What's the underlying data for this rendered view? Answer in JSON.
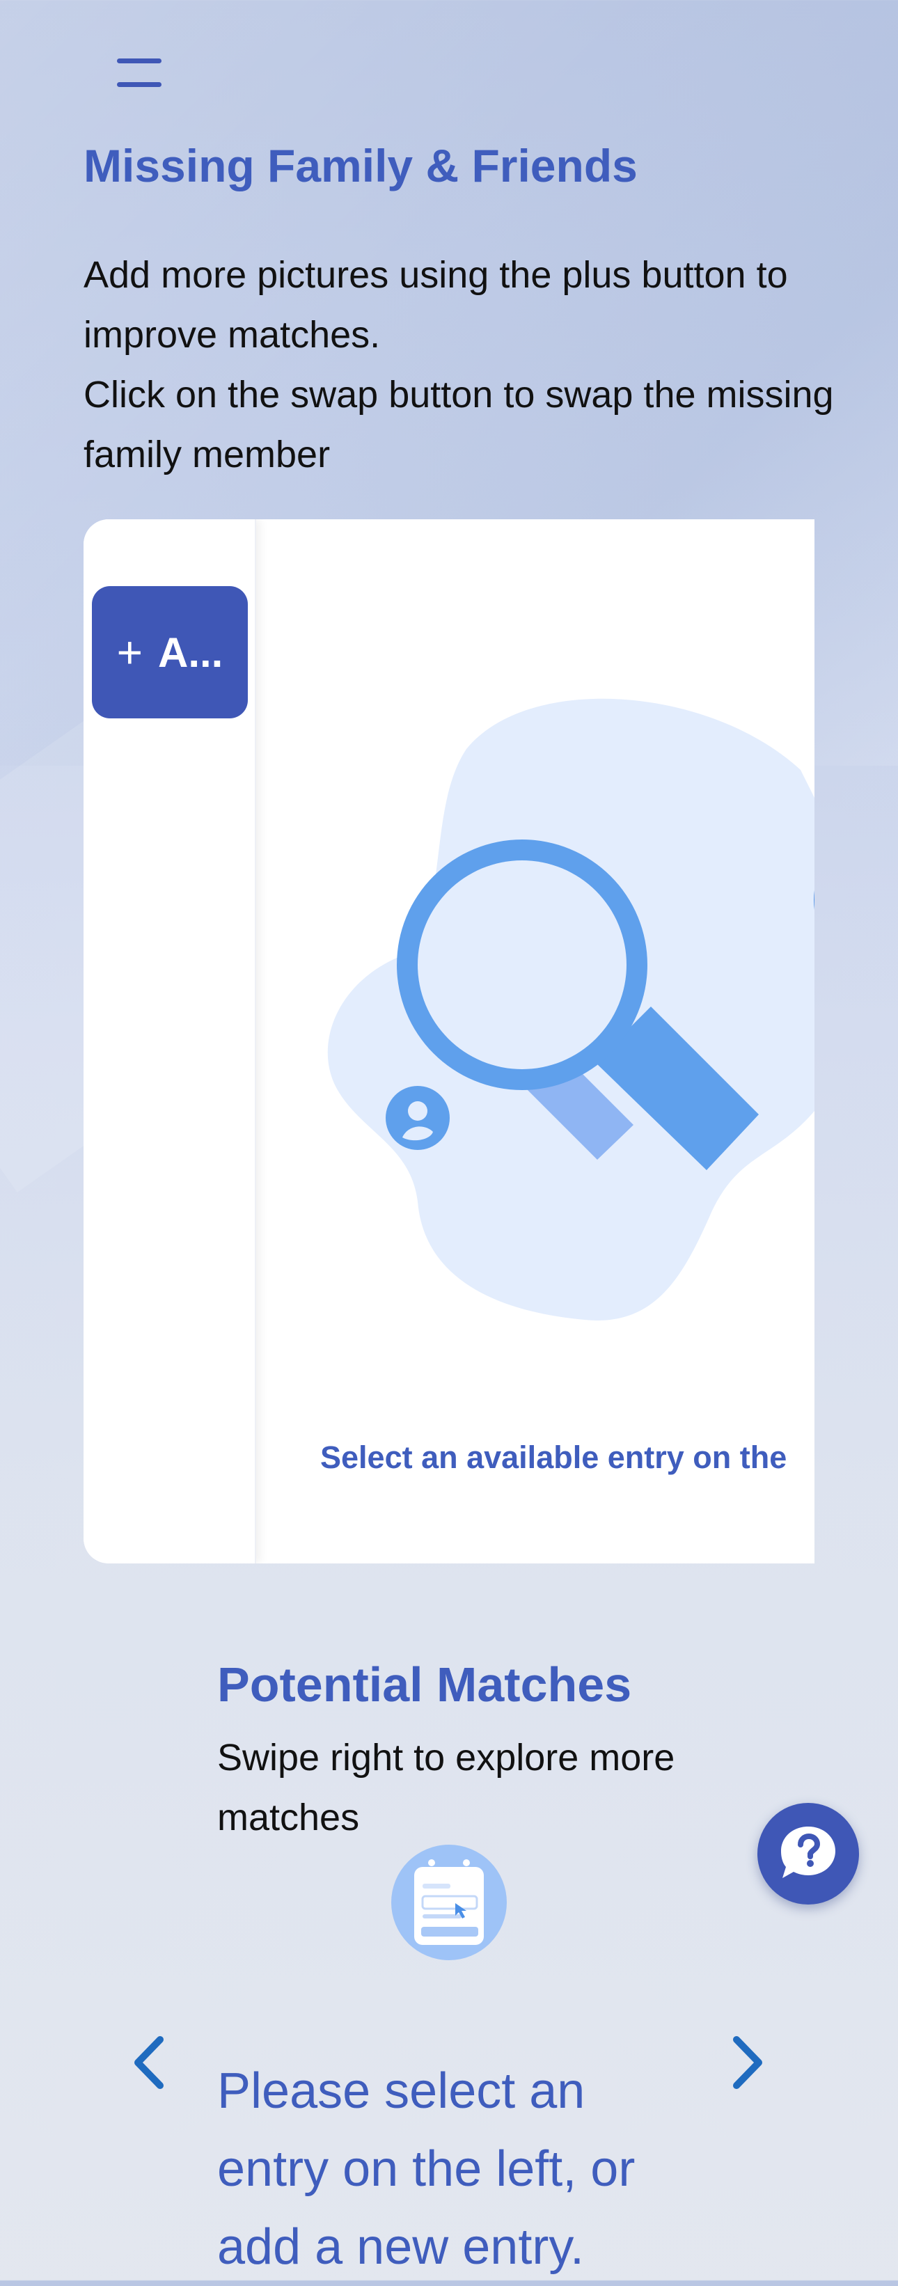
{
  "header": {
    "title": "Missing Family & Friends",
    "instructions": [
      "Add more pictures using the plus button to improve matches.",
      "Click on the swap button to swap the missing family member"
    ]
  },
  "panel": {
    "add_button_label": "A...",
    "add_button_icon": "plus-icon",
    "hint": "Select an available entry on the"
  },
  "matches": {
    "title": "Potential Matches",
    "subtitle": "Swipe right to explore more matches",
    "empty_message": "Please select an entry on the left, or add a new entry."
  },
  "colors": {
    "brand": "#3f57b6",
    "heading": "#3f5dbd",
    "illustration_light": "#e3edfd",
    "illustration_mid": "#5fa0ec",
    "illustration_dark": "#4a8fe7"
  },
  "icons": {
    "menu": "hamburger-menu-icon",
    "prev": "chevron-left-icon",
    "next": "chevron-right-icon",
    "help": "question-chat-icon",
    "search_illustration": "magnifier-search-illustration",
    "empty_state": "form-select-icon"
  }
}
